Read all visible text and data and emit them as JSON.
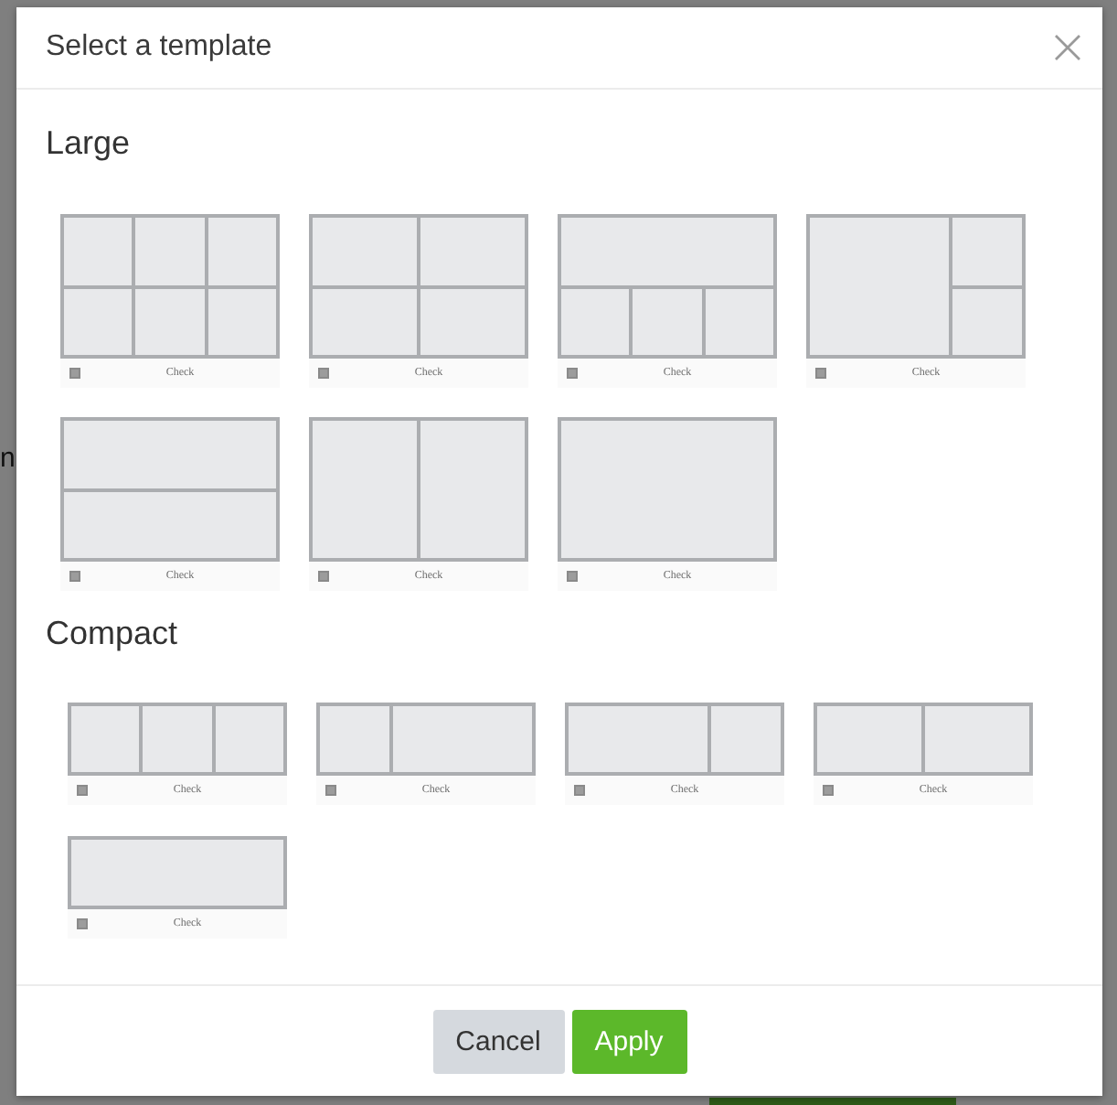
{
  "backdrop": {
    "text": "n"
  },
  "dialog": {
    "title": "Select a template"
  },
  "sections": [
    {
      "title": "Large",
      "kind": "large",
      "templates": [
        {
          "kind": "grid3x2",
          "caption": "Check"
        },
        {
          "kind": "grid2x2",
          "caption": "Check"
        },
        {
          "kind": "topwide",
          "caption": "Check"
        },
        {
          "kind": "leftbig",
          "caption": "Check"
        },
        {
          "kind": "rows",
          "caption": "Check"
        },
        {
          "kind": "halves",
          "caption": "Check"
        },
        {
          "kind": "single",
          "caption": "Check"
        }
      ]
    },
    {
      "title": "Compact",
      "kind": "compact",
      "templates": [
        {
          "kind": "thirds",
          "caption": "Check"
        },
        {
          "kind": "leftnarrow",
          "caption": "Check"
        },
        {
          "kind": "rightnarrow",
          "caption": "Check"
        },
        {
          "kind": "halves",
          "caption": "Check"
        },
        {
          "kind": "single",
          "caption": "Check"
        }
      ]
    }
  ],
  "buttons": [
    {
      "label": "Cancel",
      "kind": "secondary"
    },
    {
      "label": "Apply",
      "kind": "primary"
    }
  ]
}
